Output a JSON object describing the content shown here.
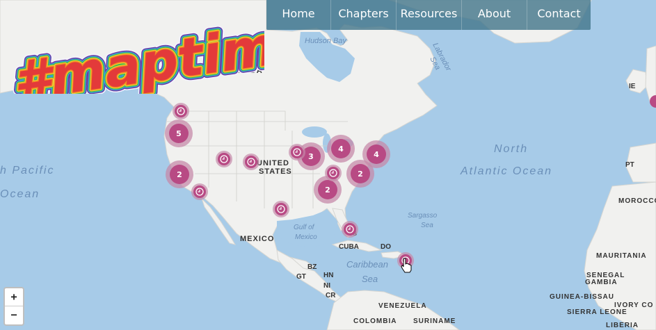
{
  "nav": {
    "home": "Home",
    "chapters": "Chapters",
    "resources": "Resources",
    "about": "About",
    "contact": "Contact"
  },
  "logo": {
    "text": "#maptime!"
  },
  "zoom": {
    "in": "+",
    "out": "−"
  },
  "map_labels": {
    "hudson_bay": "Hudson Bay",
    "labrador_sea_1": "Labrador",
    "labrador_sea_2": "Sea",
    "canada": "CANADA",
    "united_states_1": "UNITED",
    "united_states_2": "STATES",
    "mexico": "MEXICO",
    "north_atlantic_1": "North",
    "north_atlantic_2": "Atlantic Ocean",
    "north_pacific_1": "h Pacific",
    "north_pacific_2": "Ocean",
    "gulf_mexico_1": "Gulf of",
    "gulf_mexico_2": "Mexico",
    "sargasso_1": "Sargasso",
    "sargasso_2": "Sea",
    "cuba": "CUBA",
    "do": "DO",
    "caribbean_1": "Caribbean",
    "caribbean_2": "Sea",
    "bz": "BZ",
    "gt": "GT",
    "hn": "HN",
    "ni": "NI",
    "cr": "CR",
    "venezuela": "VENEZUELA",
    "colombia": "COLOMBIA",
    "suriname": "SURINAME",
    "ie": "IE",
    "pt": "PT",
    "morocco": "MOROCCO",
    "mauritania": "MAURITANIA",
    "senegal": "SENEGAL",
    "gambia": "GAMBIA",
    "guinea_bissau": "GUINEA-BISSAU",
    "sierra_leone": "SIERRA LEONE",
    "ivory_coast": "IVORY CO",
    "liberia": "LIBERIA",
    "florida_partial": "s"
  },
  "clusters": [
    {
      "name": "cluster-pacific-northwest",
      "count": "5"
    },
    {
      "name": "cluster-california",
      "count": "2"
    },
    {
      "name": "cluster-chicago",
      "count": "3"
    },
    {
      "name": "cluster-great-lakes",
      "count": "4"
    },
    {
      "name": "cluster-northeast",
      "count": "4"
    },
    {
      "name": "cluster-carolinas",
      "count": "2"
    },
    {
      "name": "cluster-southeast",
      "count": "2"
    }
  ],
  "marker_icon": "clock-icon",
  "colors": {
    "marker": "#b84a84",
    "cluster_halo": "#c58aa9",
    "nav_bg": "#46788c",
    "water": "#a7cbe8",
    "land": "#f1f1ef"
  }
}
